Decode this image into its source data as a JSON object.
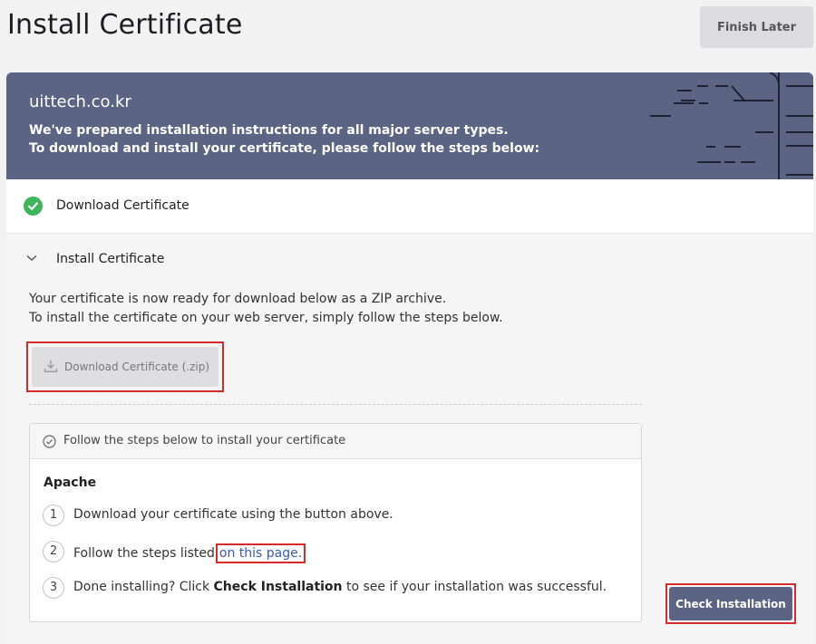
{
  "header": {
    "title": "Install Certificate",
    "finish_later_label": "Finish Later"
  },
  "banner": {
    "domain": "uittech.co.kr",
    "line1": "We've prepared installation instructions for all major server types.",
    "line2": "To download and install your certificate, please follow the steps below:",
    "color": "#5b6583"
  },
  "steps": {
    "download": {
      "label": "Download Certificate",
      "status": "complete",
      "status_color": "#3db55a"
    },
    "install": {
      "label": "Install Certificate",
      "expanded": true,
      "ready_line1": "Your certificate is now ready for download below as a ZIP archive.",
      "ready_line2": "To install the certificate on your web server, simply follow the steps below.",
      "download_zip_label": "Download Certificate (.zip)"
    }
  },
  "instructions": {
    "heading": "Follow the steps below to install your certificate",
    "server": "Apache",
    "step1": {
      "number": "1",
      "text": "Download your certificate using the button above."
    },
    "step2": {
      "number": "2",
      "text_before": "Follow the steps listed",
      "link_text": "on this page."
    },
    "step3": {
      "number": "3",
      "text_before": "Done installing? Click",
      "bold": "Check Installation",
      "text_after": "to see if your installation was successful."
    }
  },
  "actions": {
    "check_installation_label": "Check Installation"
  },
  "colors": {
    "accent": "#5b6583",
    "highlight_border": "#d62b2b",
    "link": "#3a5bb5"
  }
}
